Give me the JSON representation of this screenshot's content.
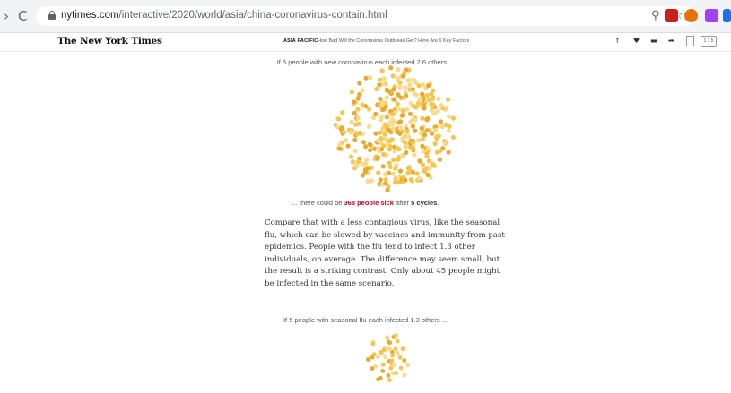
{
  "browser": {
    "url_host": "nytimes.com",
    "url_path": "/interactive/2020/world/asia/china-coronavirus-contain.html"
  },
  "nyt_header": {
    "logo": "The New York Times",
    "section": "ASIA PACIFIC",
    "headline": "How Bad Will the Coronavirus Outbreak Get? Here Are 6 Key Factors",
    "comment_label": "1 1 5"
  },
  "article": {
    "caption_top": "If 5 people with new coronavirus each infected 2.6 others ...",
    "result_prefix": "... there could be ",
    "result_sick": "368 people sick",
    "result_mid": " after ",
    "result_cycles": "5 cycles",
    "result_suffix": ".",
    "paragraph": "Compare that with a less contagious virus, like the seasonal flu, which can be slowed by vaccines and immunity from past epidemics. People with the flu tend to infect 1.3 other individuals, on average. The difference may seem small, but the result is a striking contrast: Only about 45 people might be infected in the same scenario.",
    "caption_bottom": "If 5 people with seasonal flu each infected 1.3 others ..."
  },
  "colors": {
    "dot_light": "#f9d98a",
    "dot_mid": "#f5c54d",
    "dot_dark": "#eaa92a",
    "accent_red": "#d0021b"
  },
  "clusters": {
    "coronavirus_count": 368,
    "flu_count": 45
  }
}
